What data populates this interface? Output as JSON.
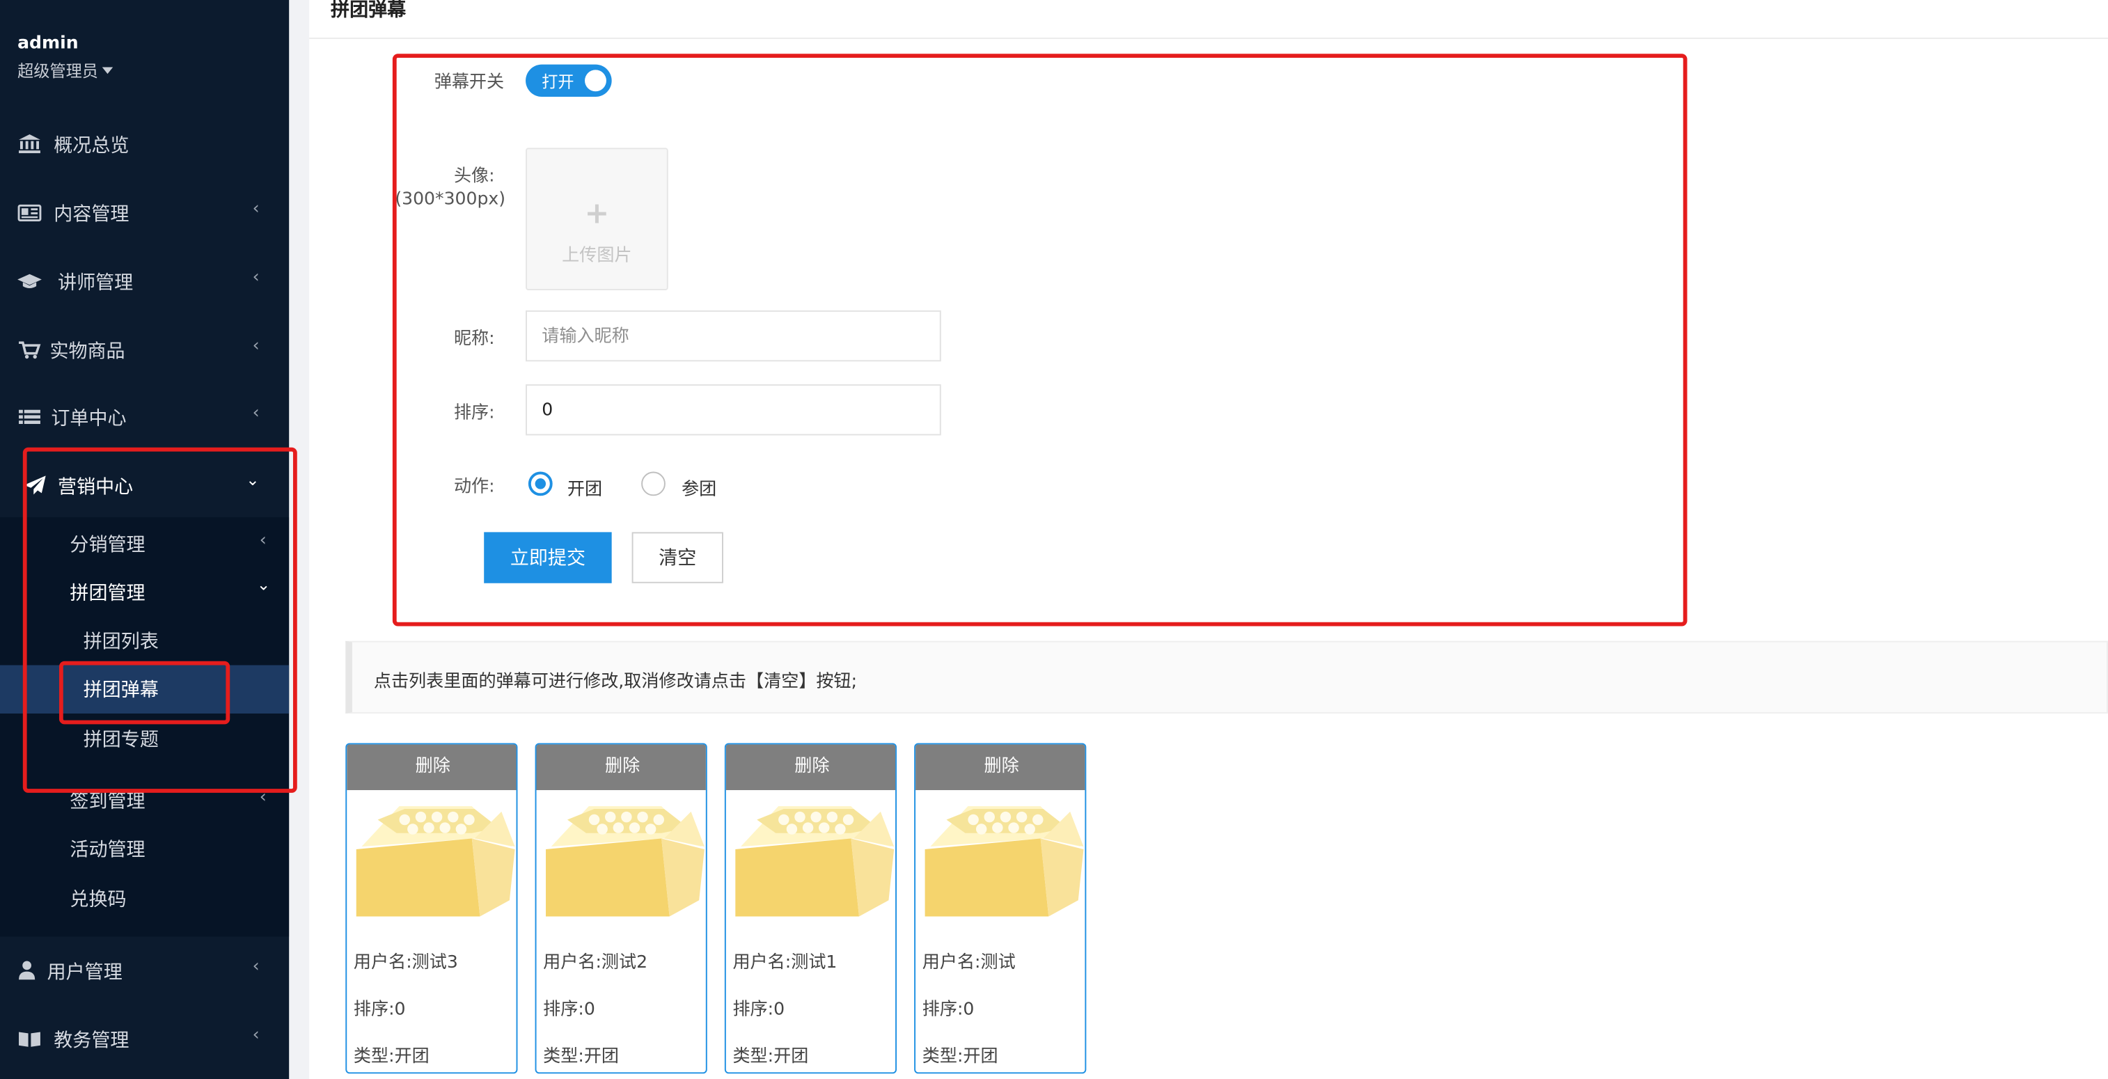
{
  "user": {
    "name": "admin",
    "role": "超级管理员"
  },
  "sidebar": {
    "items": [
      {
        "label": "概况总览",
        "icon": "bank-icon"
      },
      {
        "label": "内容管理",
        "icon": "newspaper-icon"
      },
      {
        "label": "讲师管理",
        "icon": "graduation-cap-icon"
      },
      {
        "label": "实物商品",
        "icon": "cart-icon"
      },
      {
        "label": "订单中心",
        "icon": "list-icon"
      },
      {
        "label": "营销中心",
        "icon": "paper-plane-icon"
      },
      {
        "label": "用户管理",
        "icon": "user-icon"
      },
      {
        "label": "教务管理",
        "icon": "book-icon"
      }
    ],
    "marketing_sub": [
      "分销管理",
      "拼团管理",
      "签到管理",
      "活动管理",
      "兑换码"
    ],
    "group_sub": [
      "拼团列表",
      "拼团弹幕",
      "拼团专题"
    ]
  },
  "page": {
    "title": "拼团弹幕"
  },
  "form": {
    "switch_label": "弹幕开关",
    "switch_text": "打开",
    "avatar_label": "头像:",
    "avatar_hint": "(300*300px)",
    "upload_text": "上传图片",
    "nickname_label": "昵称:",
    "nickname_placeholder": "请输入昵称",
    "sort_label": "排序:",
    "sort_value": "0",
    "action_label": "动作:",
    "action_open": "开团",
    "action_join": "参团",
    "submit": "立即提交",
    "clear": "清空"
  },
  "tip": "点击列表里面的弹幕可进行修改,取消修改请点击【清空】按钮;",
  "cards": [
    {
      "delete": "删除",
      "user": "用户名:测试3",
      "sort": "排序:0",
      "type": "类型:开团"
    },
    {
      "delete": "删除",
      "user": "用户名:测试2",
      "sort": "排序:0",
      "type": "类型:开团"
    },
    {
      "delete": "删除",
      "user": "用户名:测试1",
      "sort": "排序:0",
      "type": "类型:开团"
    },
    {
      "delete": "删除",
      "user": "用户名:测试",
      "sort": "排序:0",
      "type": "类型:开团"
    }
  ],
  "colors": {
    "sidebar": "#0c1b2e",
    "accent": "#1e90e3",
    "highlight": "#e51d1d"
  }
}
